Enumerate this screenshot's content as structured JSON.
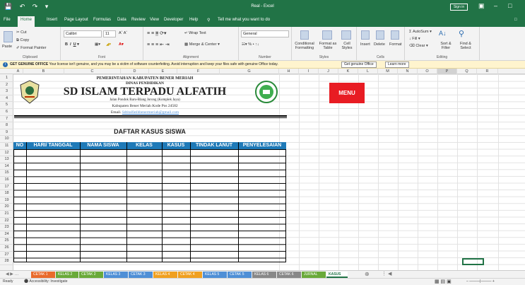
{
  "title": "Real - Excel",
  "signin": "Sign in",
  "tabs": [
    "File",
    "Home",
    "Insert",
    "Page Layout",
    "Formulas",
    "Data",
    "Review",
    "View",
    "Developer",
    "Help"
  ],
  "tell_me": "Tell me what you want to do",
  "ribbon": {
    "clipboard": {
      "paste": "Paste",
      "cut": "Cut",
      "copy": "Copy",
      "format_painter": "Format Painter",
      "label": "Clipboard"
    },
    "font": {
      "name": "Calibri",
      "size": "11",
      "label": "Font"
    },
    "alignment": {
      "wrap": "Wrap Text",
      "merge": "Merge & Center",
      "label": "Alignment"
    },
    "number": {
      "format": "General",
      "label": "Number"
    },
    "styles": {
      "cond": "Conditional Formatting",
      "table": "Format as Table",
      "cell": "Cell Styles",
      "label": "Styles"
    },
    "cells": {
      "insert": "Insert",
      "delete": "Delete",
      "format": "Format",
      "label": "Cells"
    },
    "editing": {
      "autosum": "AutoSum",
      "fill": "Fill",
      "clear": "Clear",
      "sort": "Sort & Filter",
      "find": "Find & Select",
      "label": "Editing"
    }
  },
  "warning": {
    "bold": "GET GENUINE OFFICE",
    "text": "Your license isn't genuine, and you may be a victim of software counterfeiting. Avoid interruption and keep your files safe with genuine Office today.",
    "btn1": "Get genuine Office",
    "btn2": "Learn more"
  },
  "columns": [
    "A",
    "B",
    "C",
    "D",
    "E",
    "F",
    "G",
    "H",
    "I",
    "J",
    "K",
    "L",
    "M",
    "N",
    "O",
    "P",
    "Q",
    "R"
  ],
  "rows": [
    "1",
    "2",
    "3",
    "4",
    "5",
    "6",
    "7",
    "8",
    "9",
    "10",
    "11",
    "12",
    "13",
    "14",
    "15",
    "16",
    "17",
    "18",
    "19",
    "20",
    "21",
    "22",
    "23",
    "24",
    "25",
    "26",
    "27",
    "28"
  ],
  "doc": {
    "line1": "PEMERINTAHAN KABUPATEN BENER MERIAH",
    "line2": "DINAS PENDIDIKAN",
    "school": "SD ISLAM TERPADU ALFATIH",
    "address": "Jalan Pondok Baru-Blang Jorong (Komplek Jaya)",
    "city": "Kabupaten Bener Meriah Kode Pos 24582",
    "email_label": "Email.",
    "email": "Sdtitalfatihbenermeriah@gmail.com",
    "heading": "DAFTAR KASUS SISWA"
  },
  "menu": "MENU",
  "table_headers": [
    "NO",
    "HARI/ TANGGAL",
    "NAMA SISWA",
    "KELAS",
    "KASUS",
    "TINDAK LANUT",
    "PENYELESAIAN"
  ],
  "sheets": [
    {
      "name": "CETAK 1",
      "color": "#e96b2c"
    },
    {
      "name": "KELAS 2",
      "color": "#6aaa3a"
    },
    {
      "name": "CETAK 2",
      "color": "#6aaa3a"
    },
    {
      "name": "KELAS 3",
      "color": "#4f8fd6"
    },
    {
      "name": "CETAK 3",
      "color": "#4f8fd6"
    },
    {
      "name": "KELAS 4",
      "color": "#f0a020"
    },
    {
      "name": "CETAK 4",
      "color": "#f0a020"
    },
    {
      "name": "KELAS 5",
      "color": "#4f8fd6"
    },
    {
      "name": "CETAK 5",
      "color": "#4f8fd6"
    },
    {
      "name": "KELAS 6",
      "color": "#888888"
    },
    {
      "name": "CETAK 6",
      "color": "#888888"
    },
    {
      "name": "JURNAL",
      "color": "#6aaa3a"
    },
    {
      "name": "KASUS",
      "color": "#ffffff"
    }
  ],
  "status": {
    "ready": "Ready",
    "accessibility": "Accessibility: Investigate"
  }
}
